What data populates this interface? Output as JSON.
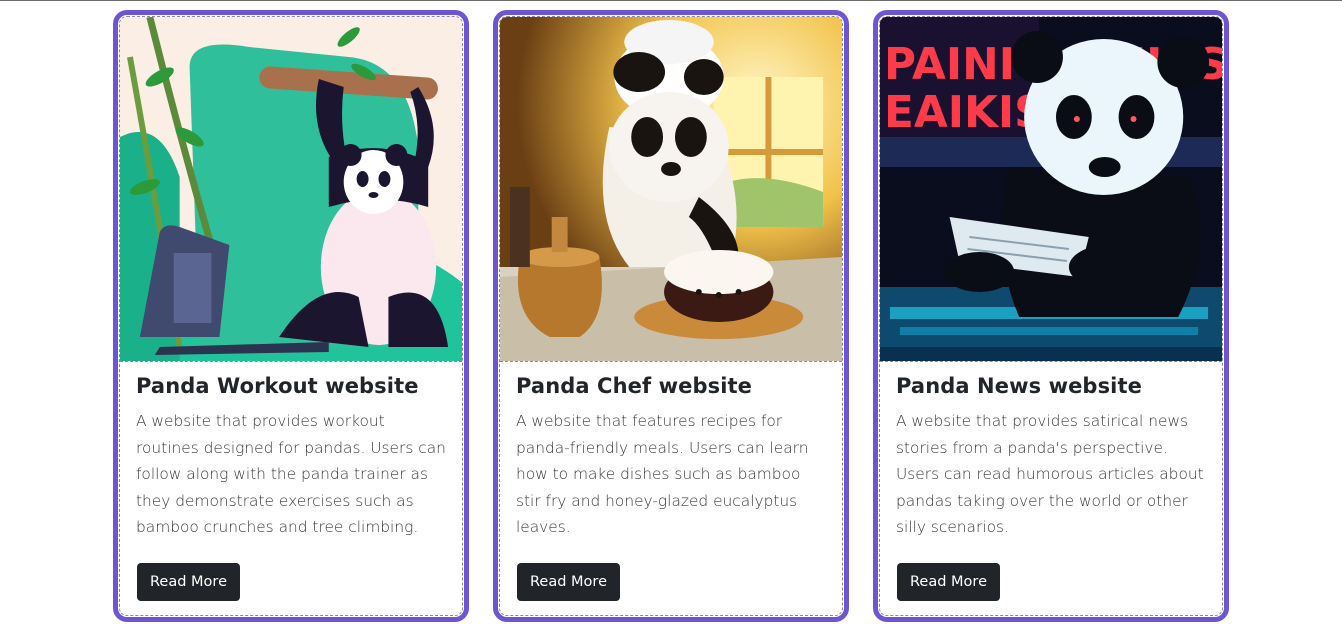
{
  "cards": [
    {
      "title": "Panda Workout website",
      "description": "A website that provides workout routines designed for pandas. Users can follow along with the panda trainer as they demonstrate exercises such as bamboo crunches and tree climbing.",
      "button_label": "Read More"
    },
    {
      "title": "Panda Chef website",
      "description": "A website that features recipes for panda-friendly meals. Users can learn how to make dishes such as bamboo stir fry and honey-glazed eucalyptus leaves.",
      "button_label": "Read More"
    },
    {
      "title": "Panda News website",
      "description": "A website that provides satirical news stories from a panda's perspective. Users can read humorous articles about pandas taking over the world or other silly scenarios.",
      "button_label": "Read More",
      "image_sign_text": "PAINIG EAIKIS"
    }
  ],
  "colors": {
    "card_border": "#6f55d4",
    "button_bg": "#212529",
    "button_text": "#ffffff",
    "title_text": "#212529"
  }
}
